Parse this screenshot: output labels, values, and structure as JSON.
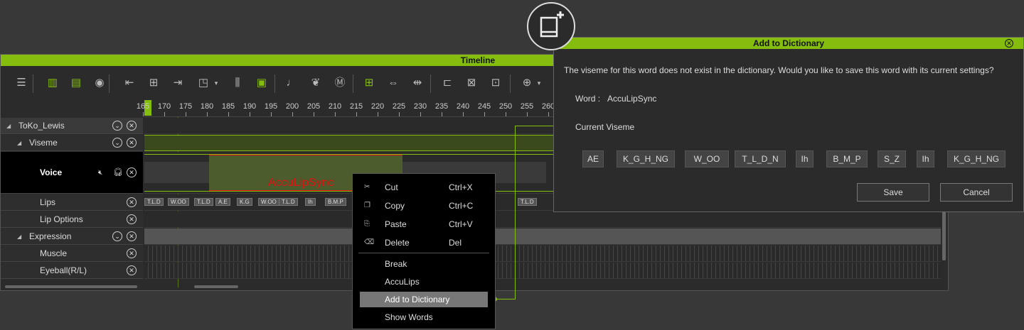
{
  "timeline": {
    "title": "Timeline",
    "ruler": [
      "165",
      "170",
      "175",
      "180",
      "185",
      "190",
      "195",
      "200",
      "205",
      "210",
      "215",
      "220",
      "225",
      "230",
      "235",
      "240",
      "245",
      "250",
      "255",
      "260"
    ],
    "playhead": "172",
    "tree": [
      {
        "label": "ToKo_Lewis",
        "level": 0,
        "expand": true,
        "opts": true
      },
      {
        "label": "Viseme",
        "level": 1,
        "expand": true,
        "opts": true
      },
      {
        "label": "Voice",
        "level": 2,
        "opts": false
      },
      {
        "label": "Lips",
        "level": 2
      },
      {
        "label": "Lip Options",
        "level": 2
      },
      {
        "label": "Expression",
        "level": 1,
        "expand": true,
        "opts": true
      },
      {
        "label": "Muscle",
        "level": 2
      },
      {
        "label": "Eyeball(R/L)",
        "level": 2
      }
    ],
    "clip_label": "AccuLipSync",
    "visemes": [
      "T.L.D",
      "W.OO",
      "T.L.D",
      "A.E",
      "K.G",
      "W.OO",
      "T.L.D",
      "Ih",
      "B.M.P"
    ],
    "viseme_right": "T.L.D"
  },
  "menu": {
    "items": [
      {
        "label": "Cut",
        "shortcut": "Ctrl+X",
        "icon": "cut-icon"
      },
      {
        "label": "Copy",
        "shortcut": "Ctrl+C",
        "icon": "copy-icon"
      },
      {
        "label": "Paste",
        "shortcut": "Ctrl+V",
        "icon": "paste-icon"
      },
      {
        "label": "Delete",
        "shortcut": "Del",
        "icon": "delete-icon"
      },
      {
        "label": "Break"
      },
      {
        "label": "AccuLips"
      },
      {
        "label": "Add to Dictionary",
        "highlighted": true
      },
      {
        "label": "Show Words"
      }
    ]
  },
  "dialog": {
    "title": "Add to Dictionary",
    "message": "The viseme for this word does not exist in the dictionary. Would you like to save this word with its current settings?",
    "word_label": "Word :",
    "word_value": "AccuLipSync",
    "viseme_label": "Current Viseme",
    "visemes": [
      "AE",
      "K_G_H_NG",
      "W_OO",
      "T_L_D_N",
      "Ih",
      "B_M_P",
      "S_Z",
      "Ih",
      "K_G_H_NG"
    ],
    "save": "Save",
    "cancel": "Cancel"
  },
  "colors": {
    "accent": "#84bd0e",
    "clip_red": "#e01010"
  }
}
